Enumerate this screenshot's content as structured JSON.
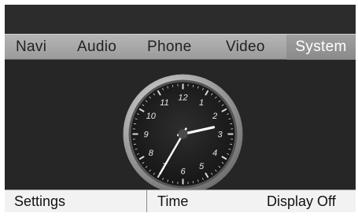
{
  "menu": {
    "items": [
      "Navi",
      "Audio",
      "Phone",
      "Video",
      "System"
    ],
    "selected_index": 4
  },
  "clock": {
    "numerals": [
      "12",
      "1",
      "2",
      "3",
      "4",
      "5",
      "6",
      "7",
      "8",
      "9",
      "10",
      "11"
    ],
    "time": {
      "hour": 2,
      "minute": 35
    }
  },
  "bottom": {
    "settings_label": "Settings",
    "time_label": "Time",
    "display_off_label": "Display Off"
  }
}
